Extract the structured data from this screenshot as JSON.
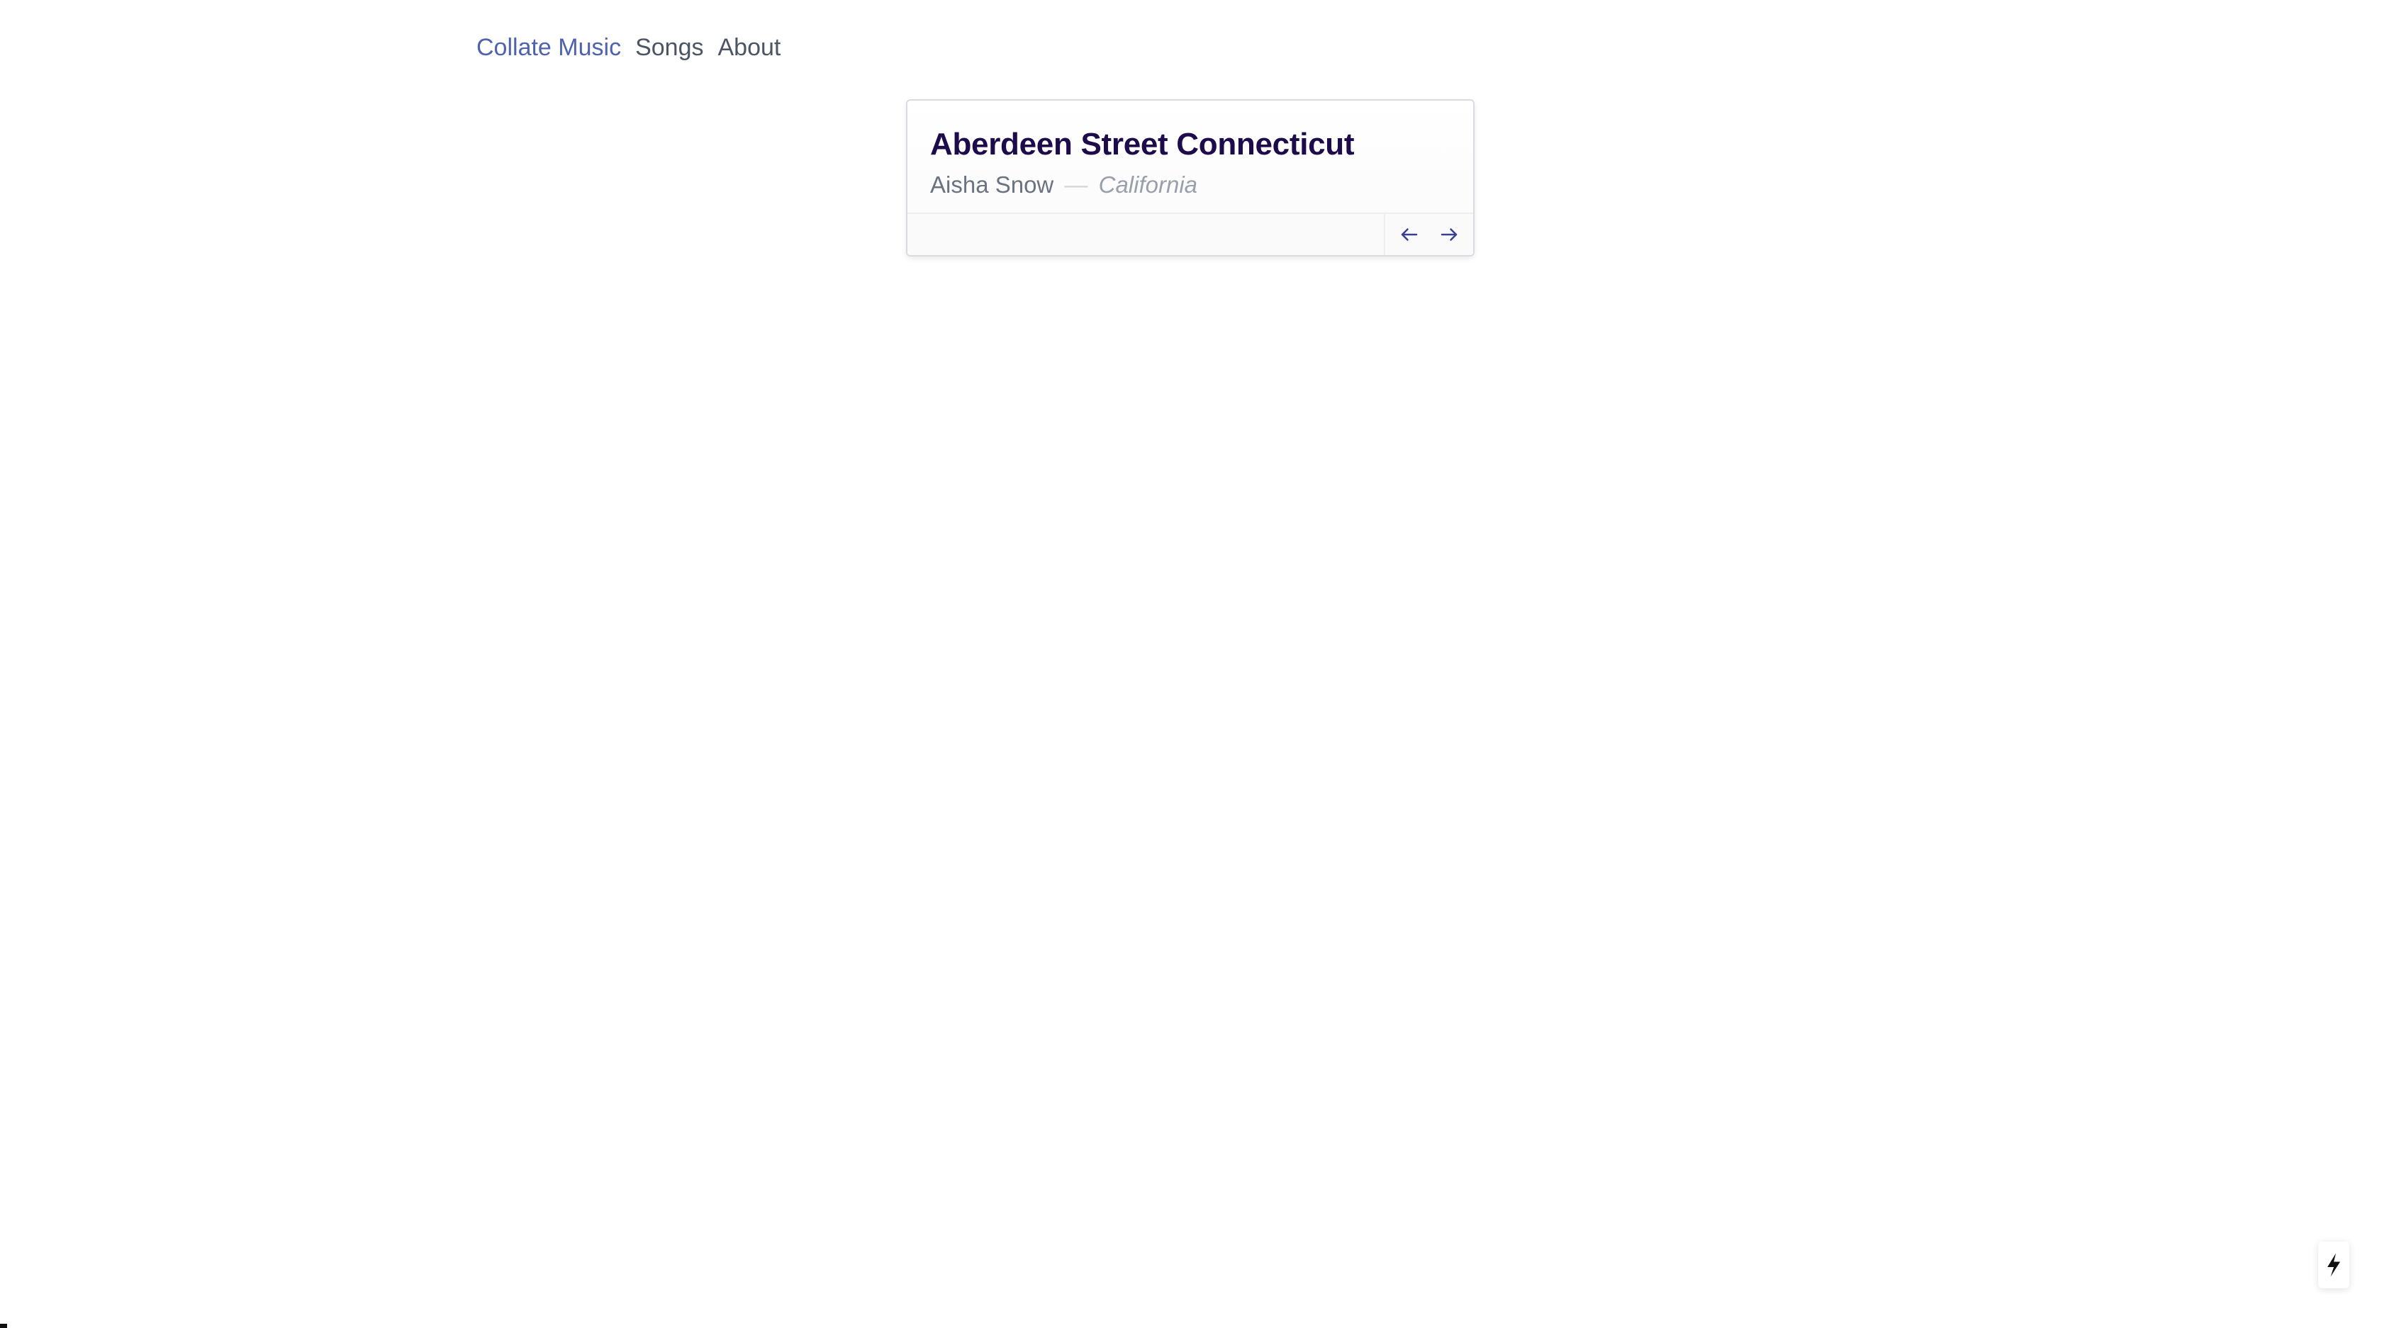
{
  "nav": {
    "brand": "Collate Music",
    "links": [
      "Songs",
      "About"
    ]
  },
  "song": {
    "title": "Aberdeen Street Connecticut",
    "artist": "Aisha Snow",
    "separator": "—",
    "album": "California"
  },
  "pager": {
    "prev_icon": "arrow-left-icon",
    "next_icon": "arrow-right-icon"
  },
  "devtools": {
    "icon": "lightning-bolt-icon"
  },
  "colors": {
    "brand": "#4f62b0",
    "title": "#1e0b4b",
    "arrows": "#3b3f8f"
  }
}
